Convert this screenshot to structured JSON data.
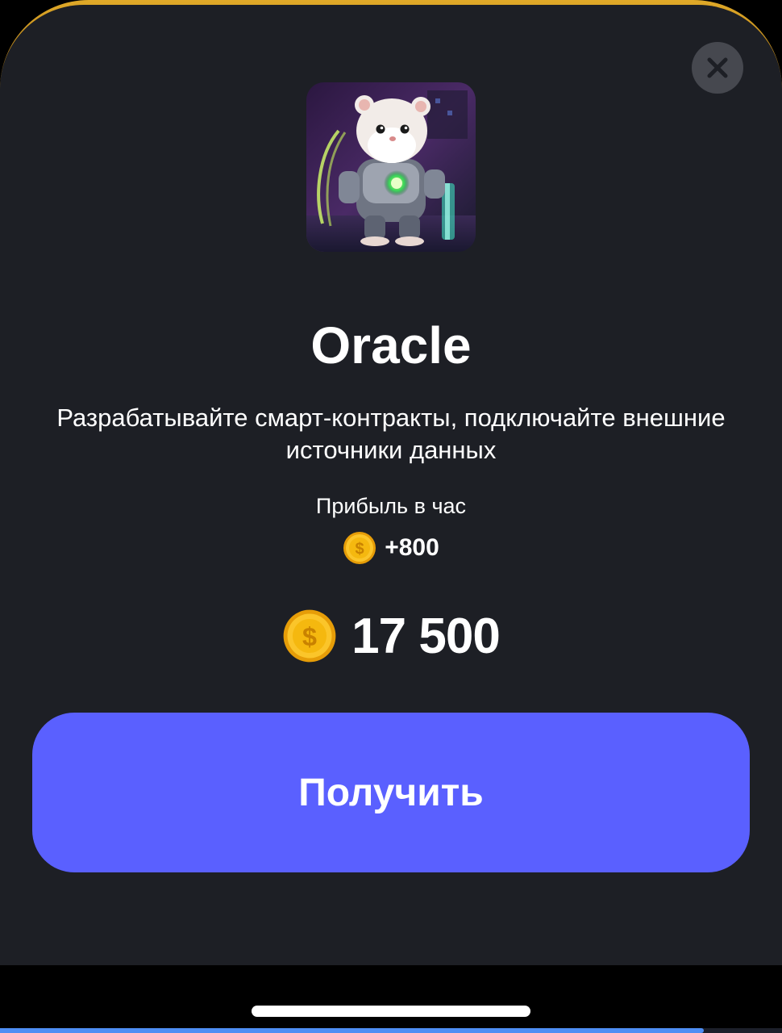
{
  "sheet": {
    "close_icon": "close-icon",
    "image_icon": "hamster-oracle-card-image",
    "title": "Oracle",
    "description": "Разрабатывайте смарт-контракты, подключайте внешние источники данных",
    "profit_label": "Прибыль в час",
    "profit_value": "+800",
    "price": "17 500",
    "coin_icon": "coin-icon",
    "action_label": "Получить"
  },
  "system": {
    "bottom_progress_fraction": 0.9
  },
  "colors": {
    "background": "#1d1f25",
    "accent_border": "#e0a928",
    "button": "#5a60ff",
    "close_button": "#46484f",
    "coin": "#f5b80f"
  }
}
